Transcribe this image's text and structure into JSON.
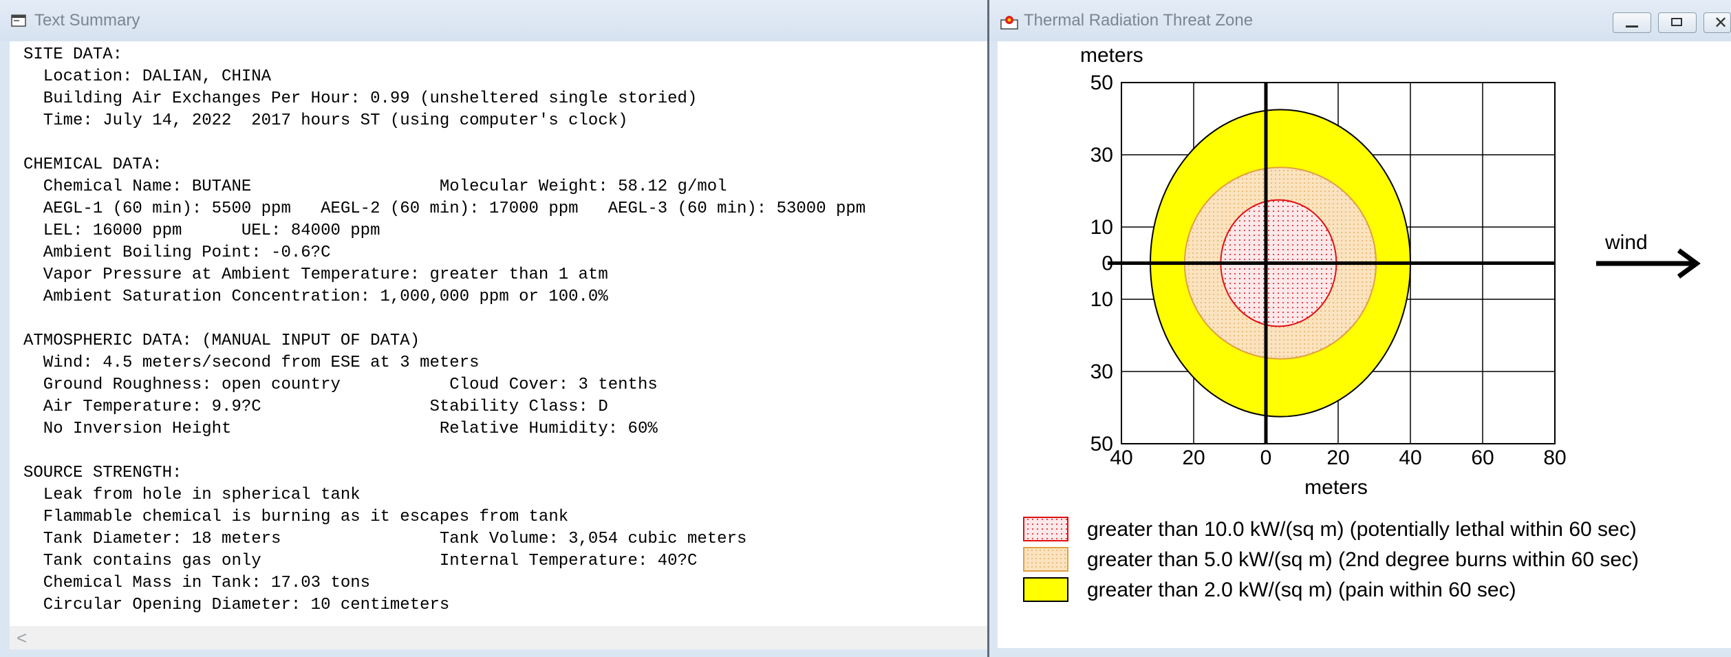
{
  "left_window": {
    "title": "Text Summary",
    "lines": [
      "SITE DATA:",
      "  Location: DALIAN, CHINA",
      "  Building Air Exchanges Per Hour: 0.99 (unsheltered single storied)",
      "  Time: July 14, 2022  2017 hours ST (using computer's clock)",
      "",
      "CHEMICAL DATA:",
      "  Chemical Name: BUTANE                   Molecular Weight: 58.12 g/mol",
      "  AEGL-1 (60 min): 5500 ppm   AEGL-2 (60 min): 17000 ppm   AEGL-3 (60 min): 53000 ppm",
      "  LEL: 16000 ppm      UEL: 84000 ppm",
      "  Ambient Boiling Point: -0.6?C",
      "  Vapor Pressure at Ambient Temperature: greater than 1 atm",
      "  Ambient Saturation Concentration: 1,000,000 ppm or 100.0%",
      "",
      "ATMOSPHERIC DATA: (MANUAL INPUT OF DATA)",
      "  Wind: 4.5 meters/second from ESE at 3 meters",
      "  Ground Roughness: open country           Cloud Cover: 3 tenths",
      "  Air Temperature: 9.9?C                 Stability Class: D",
      "  No Inversion Height                     Relative Humidity: 60%",
      "",
      "SOURCE STRENGTH:",
      "  Leak from hole in spherical tank",
      "  Flammable chemical is burning as it escapes from tank",
      "  Tank Diameter: 18 meters                Tank Volume: 3,054 cubic meters",
      "  Tank contains gas only                  Internal Temperature: 40?C",
      "  Chemical Mass in Tank: 17.03 tons",
      "  Circular Opening Diameter: 10 centimeters"
    ],
    "scroll_left_glyph": "<"
  },
  "right_window": {
    "title": "Thermal Radiation Threat Zone",
    "wind_label": "wind",
    "legend": [
      {
        "text": "greater than 10.0 kW/(sq m) (potentially lethal within 60 sec)",
        "fill": "#fde8ea",
        "stroke": "#e01010",
        "pattern": "dots-red"
      },
      {
        "text": "greater than 5.0 kW/(sq m) (2nd degree burns within 60 sec)",
        "fill": "#fbe3c0",
        "stroke": "#e0a040",
        "pattern": "dots-orange"
      },
      {
        "text": "greater than 2.0 kW/(sq m) (pain within 60 sec)",
        "fill": "#ffff00",
        "stroke": "#000000",
        "pattern": "solid"
      }
    ]
  },
  "chart_data": {
    "type": "area",
    "xlabel": "meters",
    "ylabel": "meters",
    "xlim": [
      -40,
      80
    ],
    "ylim": [
      -50,
      50
    ],
    "x_ticks": [
      -40,
      -20,
      0,
      20,
      40,
      60,
      80
    ],
    "x_tick_labels": [
      "40",
      "20",
      "0",
      "20",
      "40",
      "60",
      "80"
    ],
    "y_ticks": [
      50,
      30,
      10,
      0,
      -10,
      -30,
      -50
    ],
    "y_tick_labels": [
      "50",
      "30",
      "10",
      "0",
      "10",
      "30",
      "50"
    ],
    "grid": true,
    "zones": [
      {
        "name": "greater than 2.0 kW/(sq m) (pain within 60 sec)",
        "cx": 4,
        "cy": 0,
        "rx": 36,
        "ry": 42.5,
        "fill": "#ffff00",
        "stroke": "#000000"
      },
      {
        "name": "greater than 5.0 kW/(sq m) (2nd degree burns within 60 sec)",
        "cx": 4,
        "cy": 0,
        "rx": 26.5,
        "ry": 26.5,
        "fill": "#fbe3c0",
        "stroke": "#e0a040"
      },
      {
        "name": "greater than 10.0 kW/(sq m) (potentially lethal within 60 sec)",
        "cx": 3.5,
        "cy": 0,
        "rx": 16,
        "ry": 17.5,
        "fill": "#fde8ea",
        "stroke": "#e01010"
      }
    ]
  }
}
